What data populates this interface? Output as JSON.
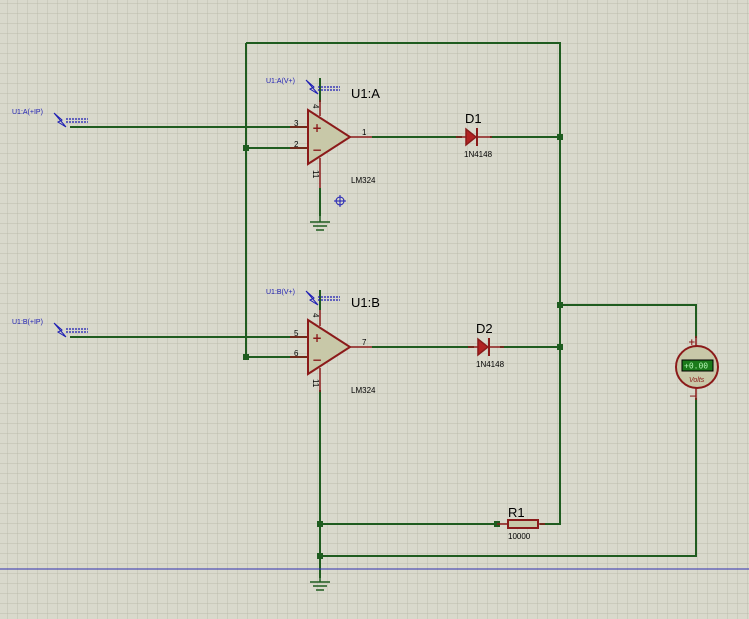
{
  "components": {
    "u1a": {
      "ref": "U1:A",
      "part": "LM324",
      "pin_in_plus": "3",
      "pin_in_minus": "2",
      "pin_out": "1",
      "pin_vplus": "4",
      "pin_vminus": "11",
      "plus_sign": "+",
      "minus_sign": "−"
    },
    "u1b": {
      "ref": "U1:B",
      "part": "LM324",
      "pin_in_plus": "5",
      "pin_in_minus": "6",
      "pin_out": "7",
      "pin_vplus": "4",
      "pin_vminus": "11",
      "plus_sign": "+",
      "minus_sign": "−"
    },
    "d1": {
      "ref": "D1",
      "part": "1N4148"
    },
    "d2": {
      "ref": "D2",
      "part": "1N4148"
    },
    "r1": {
      "ref": "R1",
      "value": "10000"
    },
    "voltmeter": {
      "display": "+0.00",
      "units": "Volts",
      "plus": "+",
      "minus": "−"
    }
  },
  "terminals": {
    "u1a_ip": "U1:A(+IP)",
    "u1a_vplus": "U1:A(V+)",
    "u1b_ip": "U1:B(+IP)",
    "u1b_vplus": "U1:B(V+)"
  },
  "colors": {
    "wire": "#1f5c1f",
    "component": "#8b1a1a",
    "terminal": "#1c1cb4",
    "background": "#d9d9cc"
  }
}
